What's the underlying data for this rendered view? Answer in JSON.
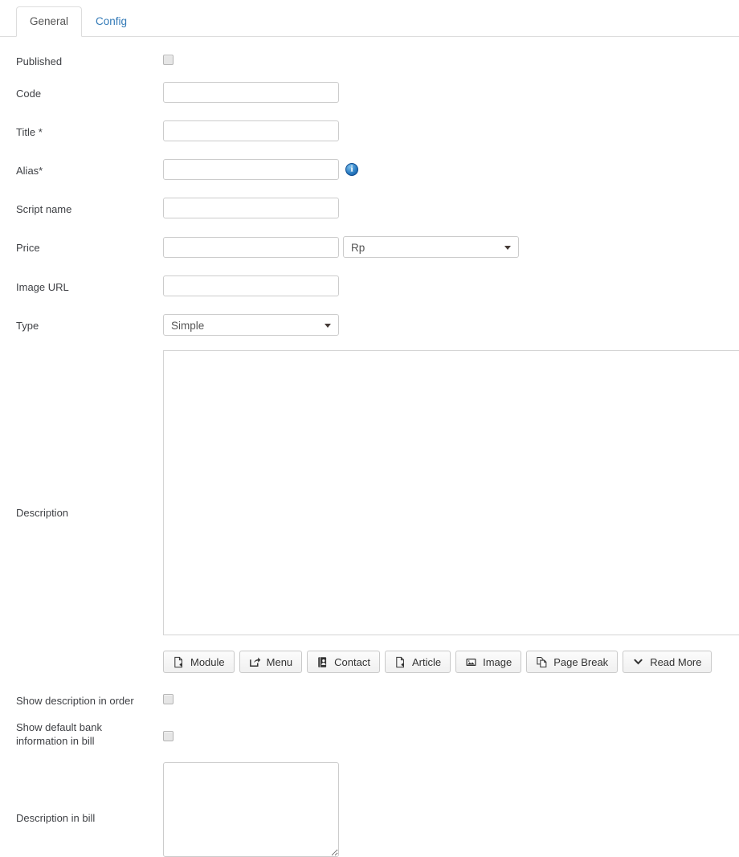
{
  "tabs": [
    {
      "label": "General",
      "active": true
    },
    {
      "label": "Config",
      "active": false
    }
  ],
  "form": {
    "published": {
      "label": "Published",
      "checked": false
    },
    "code": {
      "label": "Code",
      "value": "",
      "placeholder": ""
    },
    "title": {
      "label": "Title *",
      "value": "",
      "placeholder": ""
    },
    "alias": {
      "label": "Alias*",
      "value": "",
      "placeholder": "",
      "info_icon": "info-circle-icon"
    },
    "script_name": {
      "label": "Script name",
      "value": "",
      "placeholder": ""
    },
    "price": {
      "label": "Price",
      "value": "",
      "placeholder": "",
      "currency_selected": "Rp"
    },
    "image_url": {
      "label": "Image URL",
      "value": "",
      "placeholder": ""
    },
    "type": {
      "label": "Type",
      "selected": "Simple"
    },
    "description": {
      "label": "Description",
      "value": ""
    },
    "show_description_in_order": {
      "label": "Show description in order",
      "checked": false
    },
    "show_default_bank_information_in_bill": {
      "label": "Show default bank information in bill",
      "checked": false
    },
    "description_in_bill": {
      "label": "Description in bill",
      "value": "",
      "placeholder": ""
    }
  },
  "editor_toolbar": {
    "buttons": [
      {
        "label": "Module",
        "icon": "file-plus-icon"
      },
      {
        "label": "Menu",
        "icon": "share-export-icon"
      },
      {
        "label": "Contact",
        "icon": "address-book-icon"
      },
      {
        "label": "Article",
        "icon": "file-plus-icon"
      },
      {
        "label": "Image",
        "icon": "picture-icon"
      },
      {
        "label": "Page Break",
        "icon": "copy-pages-icon"
      },
      {
        "label": "Read More",
        "icon": "chevron-down-icon"
      }
    ]
  },
  "colors": {
    "tab_active_text": "#555555",
    "tab_link": "#337ab7",
    "label_text": "#3f4145",
    "border": "#cccccc",
    "info_icon": "#2c7fc4"
  }
}
